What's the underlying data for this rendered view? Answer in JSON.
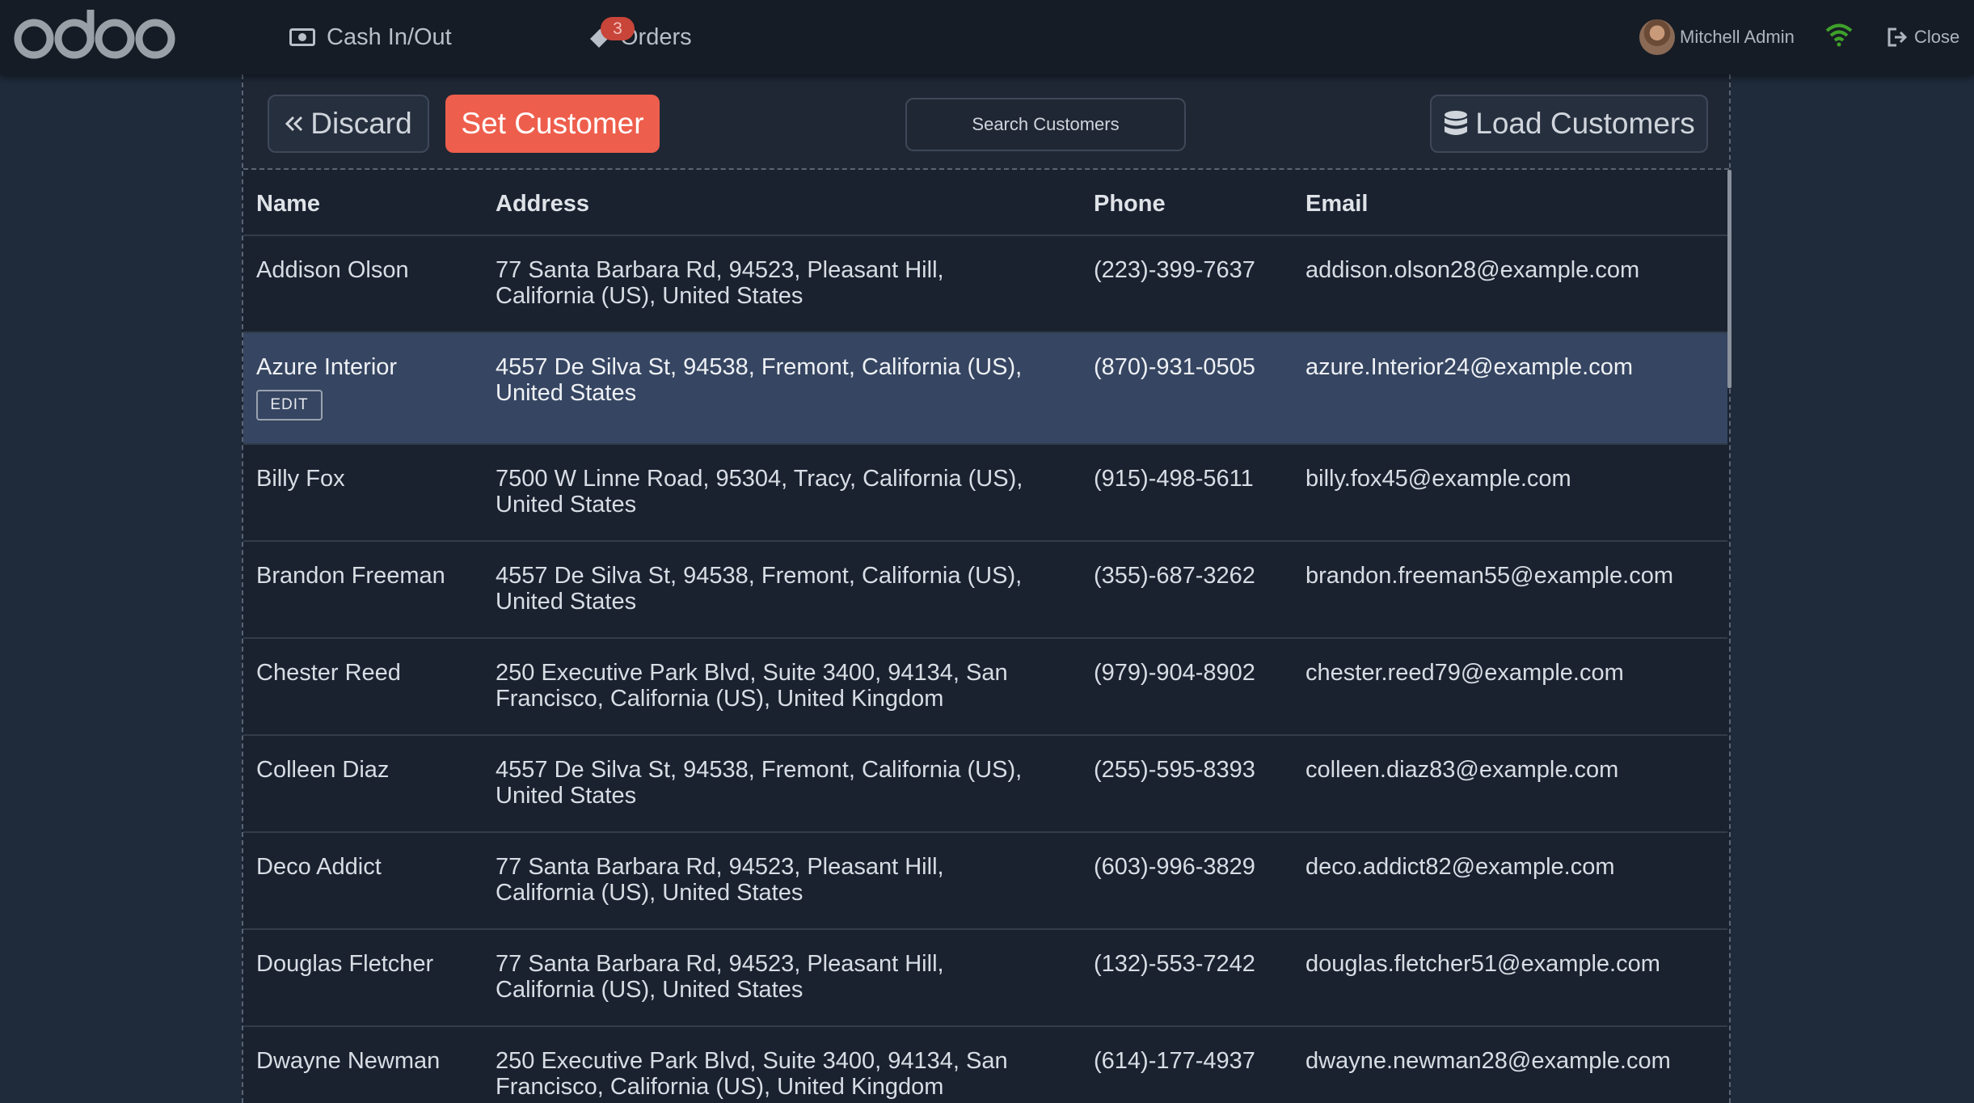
{
  "navbar": {
    "logo_text": "odoo",
    "cash_label": "Cash In/Out",
    "orders_label": "Orders",
    "orders_badge": "3",
    "user_name": "Mitchell Admin",
    "close_label": "Close",
    "icons": [
      "money-icon",
      "orders-tag-icon",
      "wifi-icon",
      "sign-out-icon"
    ],
    "colors": {
      "badge": "#c9453a",
      "wifi": "#3fa12b",
      "bar": "#161c25"
    }
  },
  "controls": {
    "discard_label": "Discard",
    "set_customer_label": "Set Customer",
    "search_placeholder": "Search Customers",
    "load_label": "Load Customers",
    "colors": {
      "accent": "#ee5e4c"
    }
  },
  "table": {
    "headers": {
      "name": "Name",
      "address": "Address",
      "phone": "Phone",
      "email": "Email"
    },
    "edit_label": "EDIT",
    "selected_row": 1,
    "rows": [
      {
        "name": "Addison Olson",
        "address": "77 Santa Barbara Rd, 94523, Pleasant Hill, California (US), United States",
        "phone": "(223)-399-7637",
        "email": "addison.olson28@example.com"
      },
      {
        "name": "Azure Interior",
        "address": "4557 De Silva St, 94538, Fremont, California (US), United States",
        "phone": "(870)-931-0505",
        "email": "azure.Interior24@example.com"
      },
      {
        "name": "Billy Fox",
        "address": "7500 W Linne Road, 95304, Tracy, California (US), United States",
        "phone": "(915)-498-5611",
        "email": "billy.fox45@example.com"
      },
      {
        "name": "Brandon Freeman",
        "address": "4557 De Silva St, 94538, Fremont, California (US), United States",
        "phone": "(355)-687-3262",
        "email": "brandon.freeman55@example.com"
      },
      {
        "name": "Chester Reed",
        "address": "250 Executive Park Blvd, Suite 3400, 94134, San Francisco, California (US), United Kingdom",
        "phone": "(979)-904-8902",
        "email": "chester.reed79@example.com"
      },
      {
        "name": "Colleen Diaz",
        "address": "4557 De Silva St, 94538, Fremont, California (US), United States",
        "phone": "(255)-595-8393",
        "email": "colleen.diaz83@example.com"
      },
      {
        "name": "Deco Addict",
        "address": "77 Santa Barbara Rd, 94523, Pleasant Hill, California (US), United States",
        "phone": "(603)-996-3829",
        "email": "deco.addict82@example.com"
      },
      {
        "name": "Douglas Fletcher",
        "address": "77 Santa Barbara Rd, 94523, Pleasant Hill, California (US), United States",
        "phone": "(132)-553-7242",
        "email": "douglas.fletcher51@example.com"
      },
      {
        "name": "Dwayne Newman",
        "address": "250 Executive Park Blvd, Suite 3400, 94134, San Francisco, California (US), United Kingdom",
        "phone": "(614)-177-4937",
        "email": "dwayne.newman28@example.com"
      }
    ]
  }
}
